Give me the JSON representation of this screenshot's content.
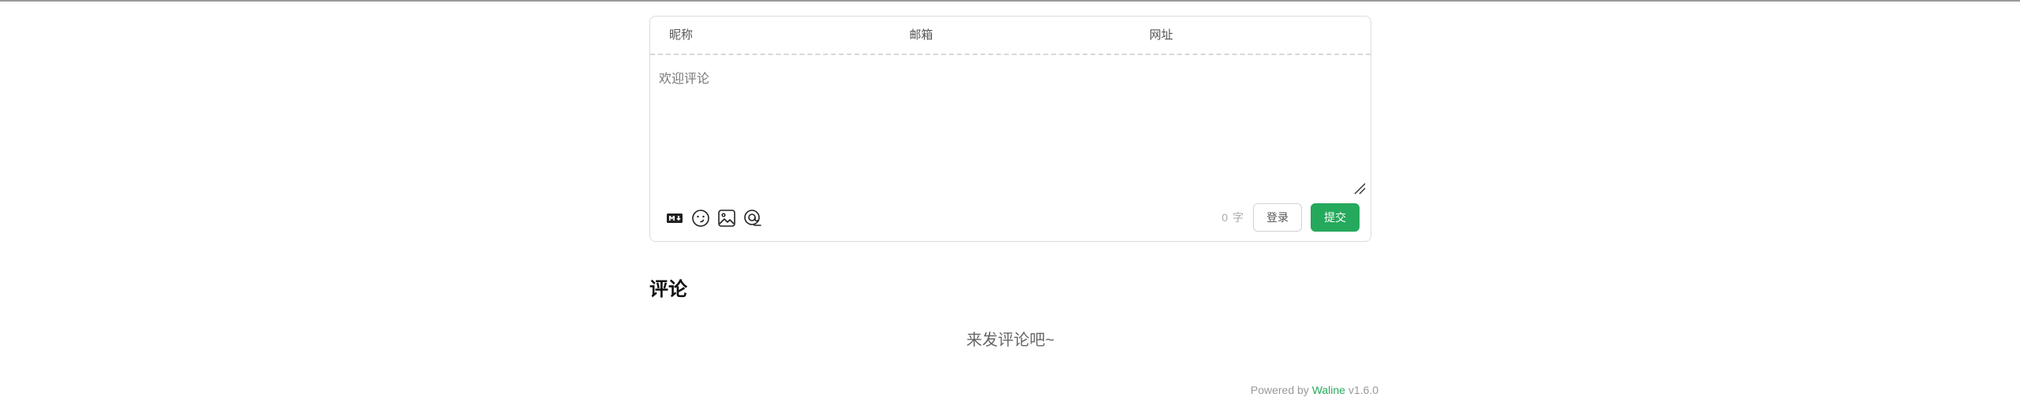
{
  "form": {
    "nick_placeholder": "昵称",
    "mail_placeholder": "邮箱",
    "link_placeholder": "网址",
    "editor_placeholder": "欢迎评论",
    "tools": [
      {
        "icon": "markdown-icon"
      },
      {
        "icon": "emoji-icon"
      },
      {
        "icon": "image-icon"
      },
      {
        "icon": "preview-icon"
      }
    ],
    "word_count": "0",
    "word_unit": "字",
    "login_label": "登录",
    "submit_label": "提交"
  },
  "comments": {
    "title": "评论",
    "empty_text": "来发评论吧~"
  },
  "footer": {
    "powered_prefix": "Powered by",
    "brand": "Waline",
    "version": "v1.6.0"
  },
  "colors": {
    "accent": "#25a95c",
    "border": "#dcdcdc",
    "muted": "#999999"
  }
}
